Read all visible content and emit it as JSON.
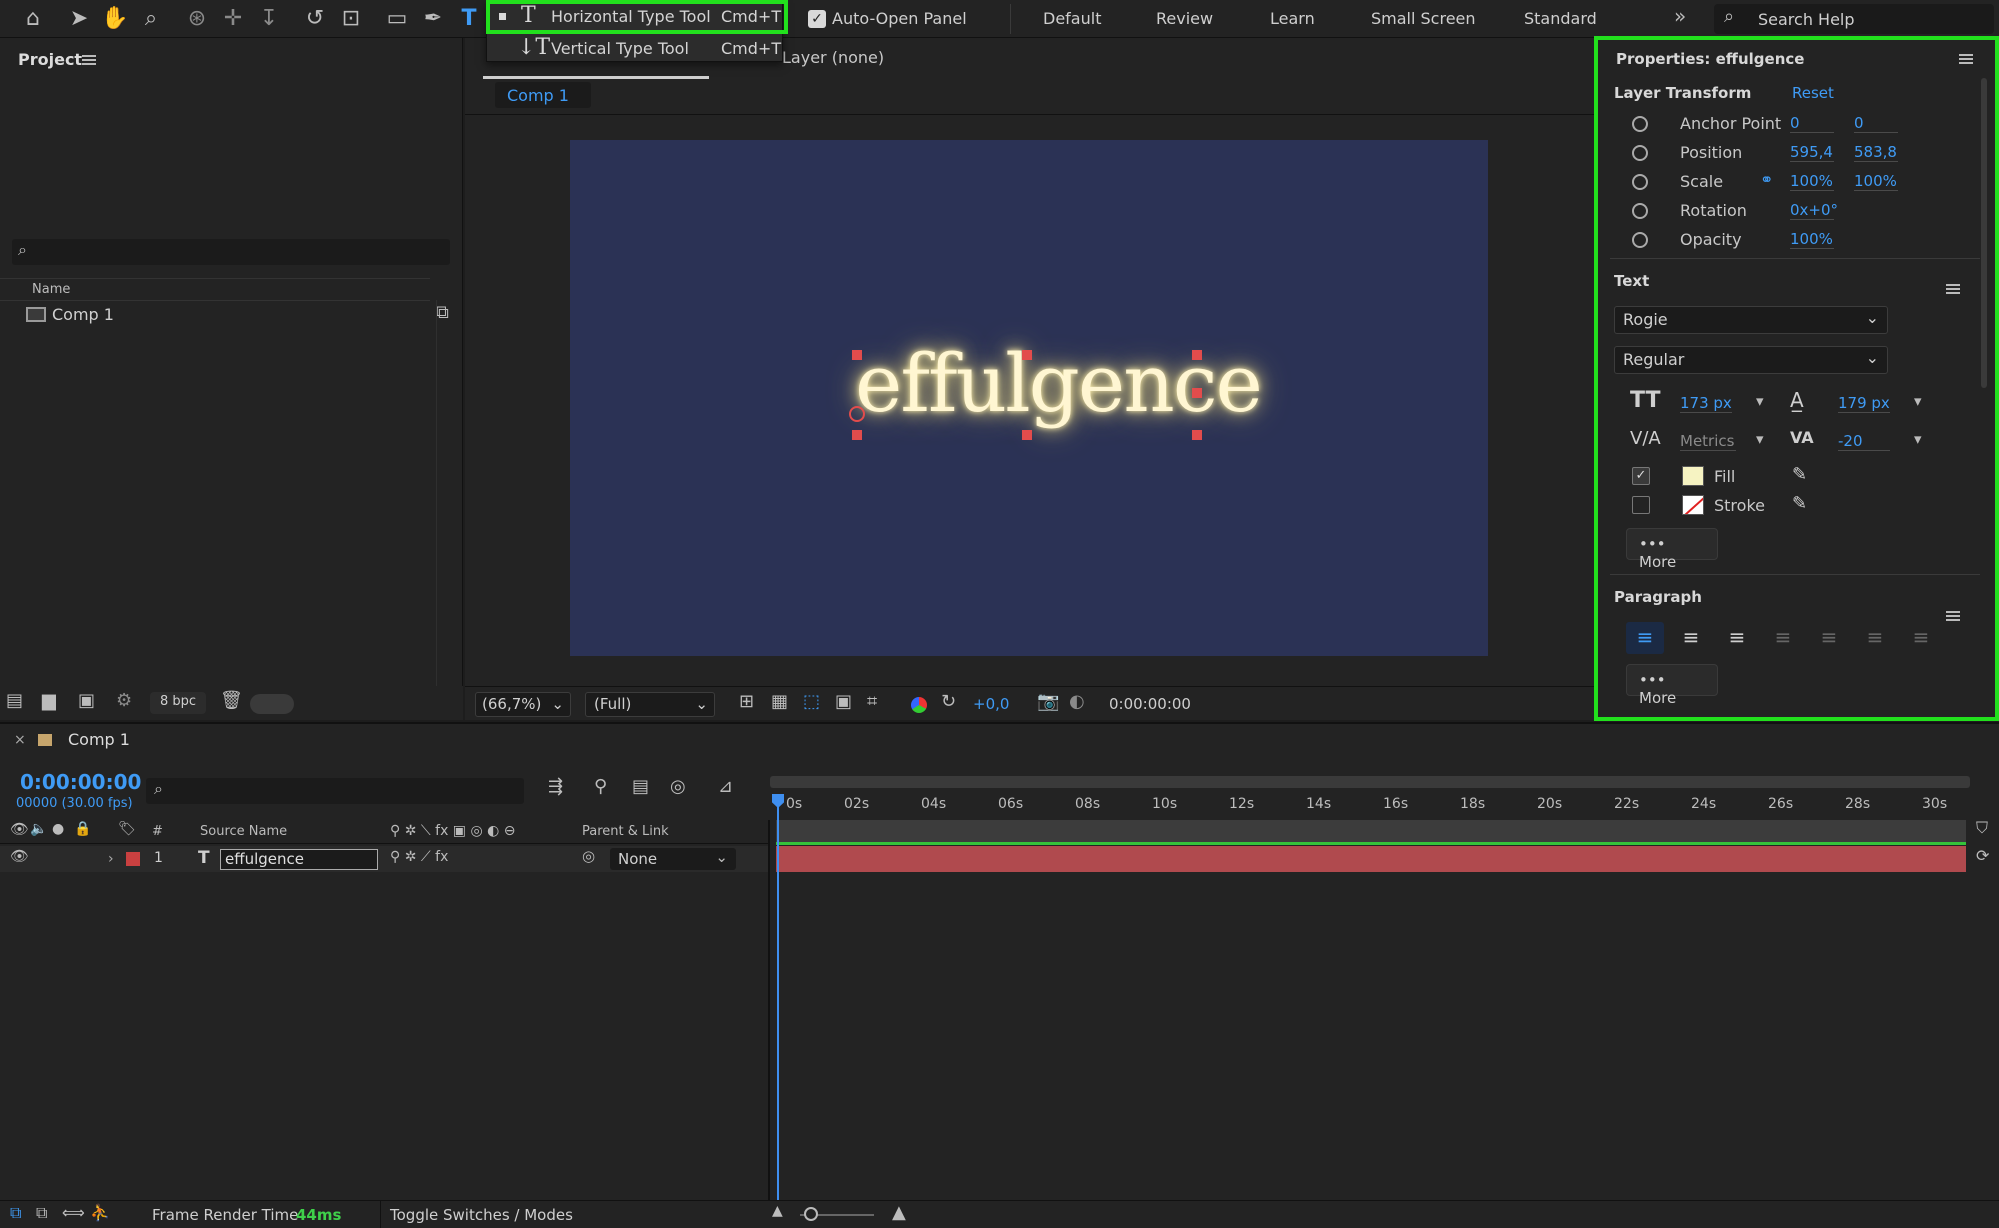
{
  "toolbar": {
    "auto_open_panel": "Auto-Open Panel",
    "workspaces": [
      "Default",
      "Review",
      "Learn",
      "Small Screen",
      "Standard"
    ],
    "search_placeholder": "Search Help"
  },
  "type_flyout": {
    "horizontal": {
      "label": "Horizontal Type Tool",
      "shortcut": "Cmd+T"
    },
    "vertical": {
      "label": "Vertical Type Tool",
      "shortcut": "Cmd+T"
    }
  },
  "project": {
    "title": "Project",
    "column_name": "Name",
    "items": [
      {
        "name": "Comp 1"
      }
    ],
    "bpc": "8 bpc"
  },
  "viewer": {
    "layer_label": "Layer (none)",
    "comp_tab": "Comp 1",
    "canvas_text": "effulgence",
    "zoom": "(66,7%)",
    "resolution": "(Full)",
    "exposure": "+0,0",
    "timecode": "0:00:00:00",
    "colors": {
      "canvas": "#2b3255",
      "text_glow": "#fff3c6"
    }
  },
  "properties": {
    "title": "Properties: effulgence",
    "layer_transform": {
      "title": "Layer Transform",
      "reset": "Reset",
      "rows": [
        {
          "label": "Anchor Point",
          "v1": "0",
          "v2": "0"
        },
        {
          "label": "Position",
          "v1": "595,4",
          "v2": "583,8"
        },
        {
          "label": "Scale",
          "v1": "100%",
          "v2": "100%"
        },
        {
          "label": "Rotation",
          "v1": "0x+0°",
          "v2": ""
        },
        {
          "label": "Opacity",
          "v1": "100%",
          "v2": ""
        }
      ]
    },
    "text": {
      "title": "Text",
      "font": "Rogie",
      "style": "Regular",
      "size": "173 px",
      "leading": "179 px",
      "kerning": "Metrics",
      "tracking": "-20",
      "fill": "Fill",
      "stroke": "Stroke",
      "more": "More",
      "fill_color": "#f6f3c2"
    },
    "paragraph": {
      "title": "Paragraph",
      "more": "More"
    }
  },
  "timeline": {
    "comp_tab": "Comp 1",
    "timecode": "0:00:00:00",
    "frames": "00000 (30.00 fps)",
    "col_hash": "#",
    "col_source": "Source Name",
    "col_parent": "Parent & Link",
    "ticks": [
      "0s",
      "02s",
      "04s",
      "06s",
      "08s",
      "10s",
      "12s",
      "14s",
      "16s",
      "18s",
      "20s",
      "22s",
      "24s",
      "26s",
      "28s",
      "30s"
    ],
    "layer": {
      "index": "1",
      "name": "effulgence",
      "parent": "None"
    }
  },
  "statusbar": {
    "frame_render_label": "Frame Render Time",
    "frame_render_value": "44ms",
    "toggle": "Toggle Switches / Modes"
  }
}
